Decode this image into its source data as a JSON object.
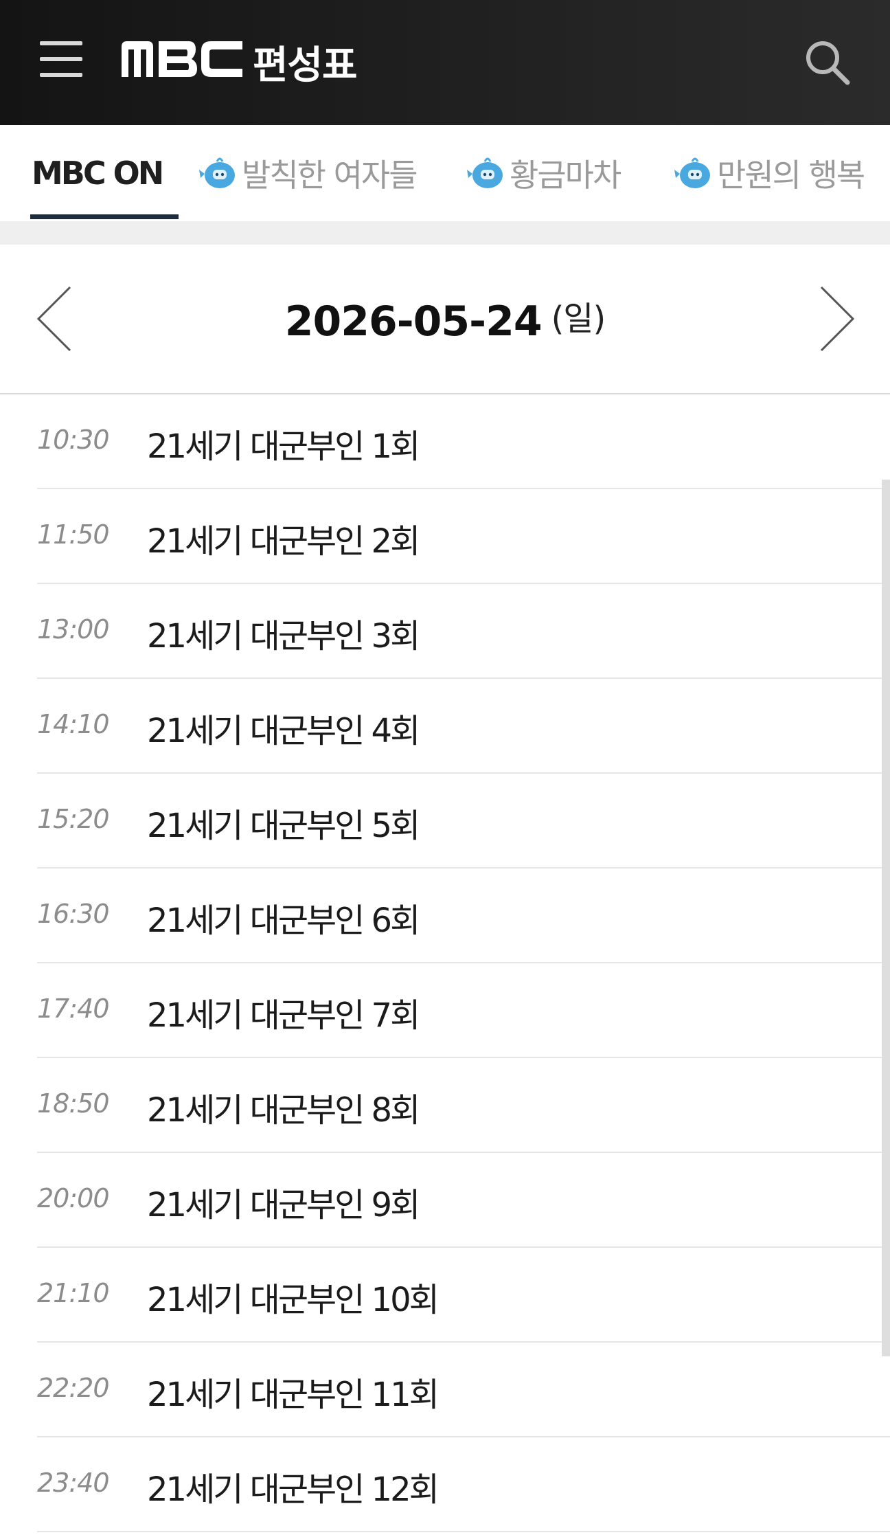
{
  "header": {
    "logo_text": "MBC",
    "title": "편성표",
    "menu_icon": "hamburger-menu-icon",
    "search_icon": "search-icon"
  },
  "tabs": [
    {
      "label": "MBC ON",
      "active": true
    },
    {
      "label": "발칙한 여자들",
      "active": false,
      "icon": "mascot-icon"
    },
    {
      "label": "황금마차",
      "active": false,
      "icon": "mascot-icon"
    },
    {
      "label": "만원의 행복",
      "active": false,
      "icon": "mascot-icon"
    }
  ],
  "date": {
    "value": "2026-05-24",
    "day": "(일)",
    "prev_icon": "chevron-left-icon",
    "next_icon": "chevron-right-icon"
  },
  "schedule": [
    {
      "time": "10:30",
      "title": "21세기 대군부인 1회"
    },
    {
      "time": "11:50",
      "title": "21세기 대군부인 2회"
    },
    {
      "time": "13:00",
      "title": "21세기 대군부인 3회"
    },
    {
      "time": "14:10",
      "title": "21세기 대군부인 4회"
    },
    {
      "time": "15:20",
      "title": "21세기 대군부인 5회"
    },
    {
      "time": "16:30",
      "title": "21세기 대군부인 6회"
    },
    {
      "time": "17:40",
      "title": "21세기 대군부인 7회"
    },
    {
      "time": "18:50",
      "title": "21세기 대군부인 8회"
    },
    {
      "time": "20:00",
      "title": "21세기 대군부인 9회"
    },
    {
      "time": "21:10",
      "title": "21세기 대군부인 10회"
    },
    {
      "time": "22:20",
      "title": "21세기 대군부인 11회"
    },
    {
      "time": "23:40",
      "title": "21세기 대군부인 12회"
    }
  ],
  "colors": {
    "header_bg": "#1c1c1c",
    "active_tab": "#1f2a3a",
    "mascot": "#4aa8e0"
  }
}
